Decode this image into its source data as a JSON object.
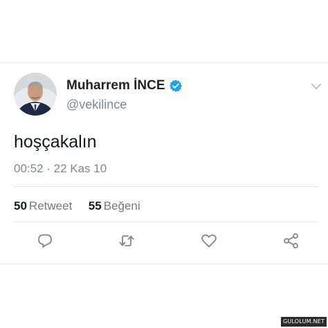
{
  "tweet": {
    "author": {
      "display_name": "Muharrem İNCE",
      "handle": "@vekilince",
      "verified": true
    },
    "text": "hoşçakalın",
    "timestamp": "00:52 · 22 Kas 10",
    "stats": {
      "retweet_count": "50",
      "retweet_label": "Retweet",
      "like_count": "55",
      "like_label": "Beğeni"
    },
    "actions": [
      "reply-icon",
      "retweet-icon",
      "like-icon",
      "share-icon"
    ]
  },
  "colors": {
    "verified_blue": "#1da1f2",
    "text_primary": "#15191d",
    "text_secondary": "#7b8791",
    "icon_gray": "#7b8791"
  },
  "watermark": "GULOLUM.NET"
}
